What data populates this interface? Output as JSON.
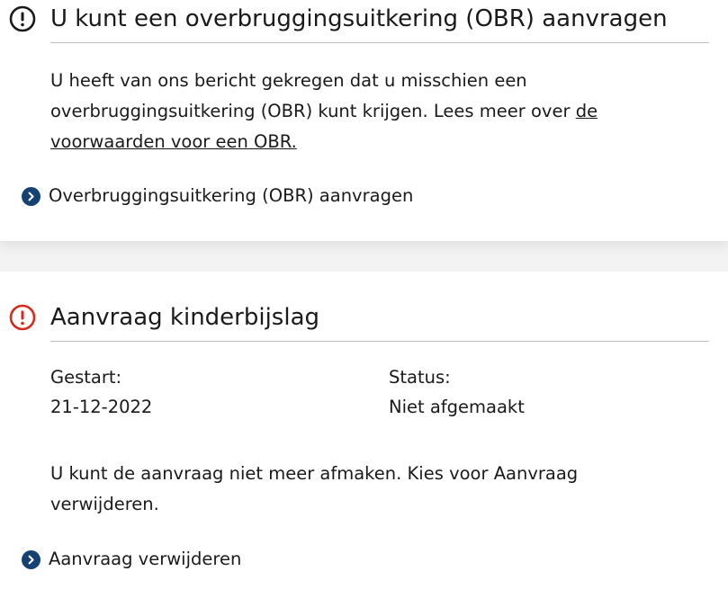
{
  "obr_card": {
    "title": "U kunt een overbruggingsuitkering (OBR) aanvragen",
    "icon": "exclamation-circle-icon",
    "icon_color": "#1a1a1a",
    "text_before_link": "U heeft van ons bericht gekregen dat u misschien een overbruggingsuitkering (OBR) kunt krijgen. Lees meer over ",
    "link_text": "de voorwaarden voor een OBR.",
    "action_label": "Overbruggingsuitkering (OBR) aanvragen"
  },
  "kinderbijslag_card": {
    "title": "Aanvraag kinderbijslag",
    "icon": "exclamation-circle-icon",
    "icon_color": "#d52b1e",
    "started_label": "Gestart:",
    "started_value": "21-12-2022",
    "status_label": "Status:",
    "status_value": "Niet afgemaakt",
    "message": "U kunt de aanvraag niet meer afmaken. Kies voor Aanvraag verwijderen.",
    "action_label": "Aanvraag verwijderen"
  },
  "colors": {
    "chevron_bg": "#154273",
    "divider": "#bdbdbd",
    "page_bg": "#f3f3f3"
  }
}
